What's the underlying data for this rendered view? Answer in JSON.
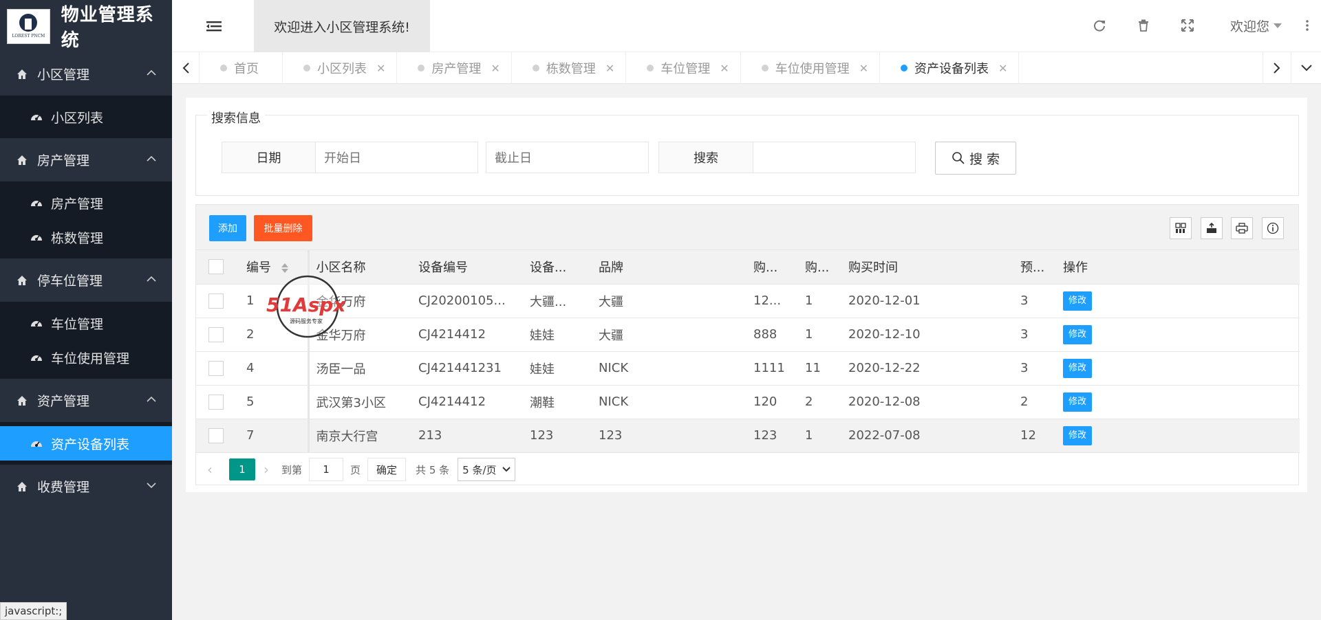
{
  "app": {
    "logo_text": "LOREST PNCM",
    "title": "物业管理系统",
    "welcome": "欢迎进入小区管理系统!",
    "user_menu": "欢迎您"
  },
  "sidebar": {
    "groups": [
      {
        "label": "小区管理",
        "expanded": true,
        "children": [
          {
            "label": "小区列表",
            "active": false
          }
        ]
      },
      {
        "label": "房产管理",
        "expanded": true,
        "children": [
          {
            "label": "房产管理",
            "active": false
          },
          {
            "label": "栋数管理",
            "active": false
          }
        ]
      },
      {
        "label": "停车位管理",
        "expanded": true,
        "children": [
          {
            "label": "车位管理",
            "active": false
          },
          {
            "label": "车位使用管理",
            "active": false
          }
        ]
      },
      {
        "label": "资产管理",
        "expanded": true,
        "children": [
          {
            "label": "资产设备列表",
            "active": true
          }
        ]
      },
      {
        "label": "收费管理",
        "expanded": false,
        "children": []
      }
    ]
  },
  "tabs": [
    {
      "label": "首页",
      "closable": false,
      "active": false
    },
    {
      "label": "小区列表",
      "closable": true,
      "active": false
    },
    {
      "label": "房产管理",
      "closable": true,
      "active": false
    },
    {
      "label": "栋数管理",
      "closable": true,
      "active": false
    },
    {
      "label": "车位管理",
      "closable": true,
      "active": false
    },
    {
      "label": "车位使用管理",
      "closable": true,
      "active": false
    },
    {
      "label": "资产设备列表",
      "closable": true,
      "active": true
    }
  ],
  "search": {
    "legend": "搜索信息",
    "date_label": "日期",
    "start_placeholder": "开始日",
    "end_placeholder": "截止日",
    "keyword_label": "搜索",
    "keyword_value": "",
    "button": "搜 索"
  },
  "toolbar": {
    "add": "添加",
    "batch_delete": "批量删除"
  },
  "table": {
    "headers": [
      "编号",
      "小区名称",
      "设备编号",
      "设备...",
      "品牌",
      "购...",
      "购...",
      "购买时间",
      "预...",
      "操作"
    ],
    "rows": [
      {
        "id": "1",
        "community": "金华万府",
        "code": "CJ20200105...",
        "device": "大疆...",
        "brand": "大疆",
        "price": "12...",
        "qty": "1",
        "date": "2020-12-01",
        "years": "3",
        "action": "修改"
      },
      {
        "id": "2",
        "community": "金华万府",
        "code": "CJ4214412",
        "device": "娃娃",
        "brand": "大疆",
        "price": "888",
        "qty": "1",
        "date": "2020-12-10",
        "years": "3",
        "action": "修改"
      },
      {
        "id": "4",
        "community": "汤臣一品",
        "code": "CJ421441231",
        "device": "娃娃",
        "brand": "NICK",
        "price": "1111",
        "qty": "11",
        "date": "2020-12-22",
        "years": "3",
        "action": "修改"
      },
      {
        "id": "5",
        "community": "武汉第3小区",
        "code": "CJ4214412",
        "device": "潮鞋",
        "brand": "NICK",
        "price": "120",
        "qty": "2",
        "date": "2020-12-08",
        "years": "2",
        "action": "修改"
      },
      {
        "id": "7",
        "community": "南京大行宫",
        "code": "213",
        "device": "123",
        "brand": "123",
        "price": "123",
        "qty": "1",
        "date": "2022-07-08",
        "years": "12",
        "action": "修改"
      }
    ]
  },
  "pager": {
    "current": "1",
    "goto_label": "到第",
    "goto_value": "1",
    "page_unit": "页",
    "confirm": "确定",
    "total": "共 5 条",
    "per_page": "5 条/页"
  },
  "watermark": {
    "brand": "51Aspx",
    "sub": "源码服务专家"
  },
  "status_bar": "javascript:;",
  "colors": {
    "sidebar_bg": "#28303d",
    "sidebar_child_bg": "#151b25",
    "active": "#1e9fff",
    "danger": "#ff5722",
    "pager_active": "#009688"
  }
}
